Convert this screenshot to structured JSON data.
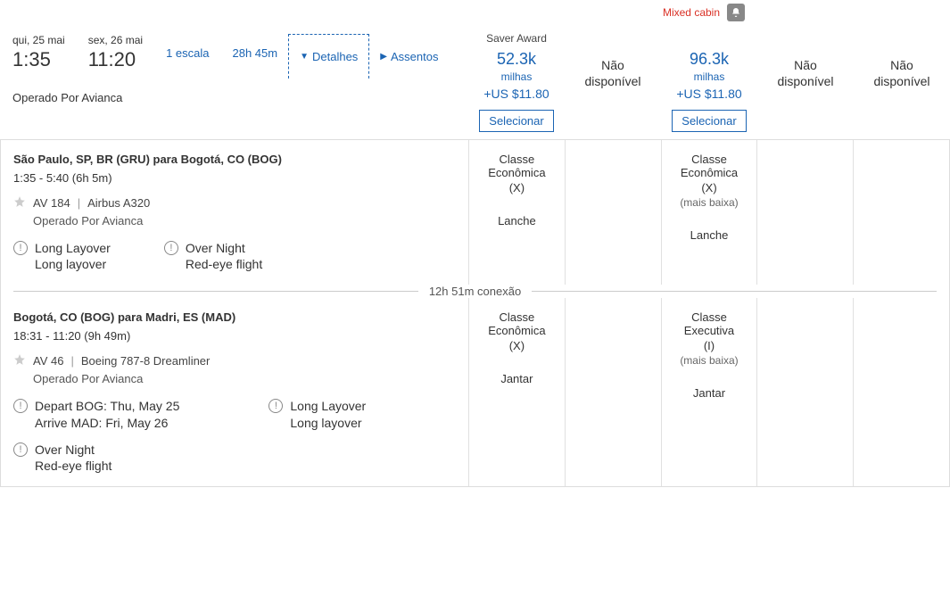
{
  "header": {
    "mixed_cabin": "Mixed cabin"
  },
  "summary": {
    "dep_date": "qui, 25 mai",
    "dep_time": "1:35",
    "arr_date": "sex, 26 mai",
    "arr_time": "11:20",
    "stops": "1 escala",
    "duration": "28h 45m",
    "tab_details": "Detalhes",
    "tab_seats": "Assentos",
    "operated": "Operado Por Avianca"
  },
  "fares": [
    {
      "badge": "Saver Award",
      "miles": "52.3k",
      "miles_label": "milhas",
      "plus": "+US $11.80",
      "select": "Selecionar"
    },
    {
      "na1": "Não",
      "na2": "disponível"
    },
    {
      "miles": "96.3k",
      "miles_label": "milhas",
      "plus": "+US $11.80",
      "select": "Selecionar"
    },
    {
      "na1": "Não",
      "na2": "disponível"
    },
    {
      "na1": "Não",
      "na2": "disponível"
    }
  ],
  "segments": [
    {
      "route": "São Paulo, SP, BR (GRU) para Bogotá, CO (BOG)",
      "times": "1:35 - 5:40 (6h 5m)",
      "flight_no": "AV 184",
      "aircraft": "Airbus A320",
      "operated": "Operado Por Avianca",
      "warnings": [
        {
          "title": "Long Layover",
          "sub": "Long layover"
        },
        {
          "title": "Over Night",
          "sub": "Red-eye flight"
        }
      ],
      "fare_cells": [
        {
          "name": "Classe Econômica",
          "code": "(X)",
          "note": "",
          "meal": "Lanche"
        },
        {},
        {
          "name": "Classe Econômica",
          "code": "(X)",
          "note": "(mais baixa)",
          "meal": "Lanche"
        },
        {},
        {}
      ]
    },
    {
      "route": "Bogotá, CO (BOG) para Madri, ES (MAD)",
      "times": "18:31 - 11:20 (9h 49m)",
      "flight_no": "AV 46",
      "aircraft": "Boeing 787-8 Dreamliner",
      "operated": "Operado Por Avianca",
      "warnings": [
        {
          "title": "Depart BOG: Thu, May 25",
          "sub": "Arrive MAD: Fri, May 26"
        },
        {
          "title": "Long Layover",
          "sub": "Long layover"
        },
        {
          "title": "Over Night",
          "sub": "Red-eye flight"
        }
      ],
      "fare_cells": [
        {
          "name": "Classe Econômica",
          "code": "(X)",
          "note": "",
          "meal": "Jantar"
        },
        {},
        {
          "name": "Classe Executiva",
          "code": "(I)",
          "note": "(mais baixa)",
          "meal": "Jantar"
        },
        {},
        {}
      ]
    }
  ],
  "connection": "12h 51m conexão"
}
